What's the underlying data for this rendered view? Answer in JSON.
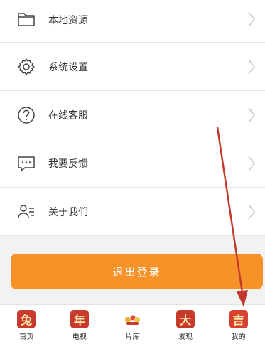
{
  "menu": {
    "items": [
      {
        "label": "本地资源",
        "icon": "folder-icon"
      },
      {
        "label": "系统设置",
        "icon": "gear-icon"
      },
      {
        "label": "在线客服",
        "icon": "question-icon"
      },
      {
        "label": "我要反馈",
        "icon": "chat-icon"
      },
      {
        "label": "关于我们",
        "icon": "user-info-icon"
      }
    ]
  },
  "logout": {
    "label": "退出登录",
    "color": "#f79228"
  },
  "tabbar": {
    "tabs": [
      {
        "label": "首页",
        "glyph": "兔",
        "icon": "home-rabbit-icon"
      },
      {
        "label": "电视",
        "glyph": "年",
        "icon": "tv-year-icon"
      },
      {
        "label": "片库",
        "glyph": "",
        "icon": "library-icon"
      },
      {
        "label": "发现",
        "glyph": "大",
        "icon": "discover-icon"
      },
      {
        "label": "我的",
        "glyph": "吉",
        "icon": "mine-icon"
      }
    ]
  },
  "annotation": {
    "arrow_color": "#c0392b"
  }
}
